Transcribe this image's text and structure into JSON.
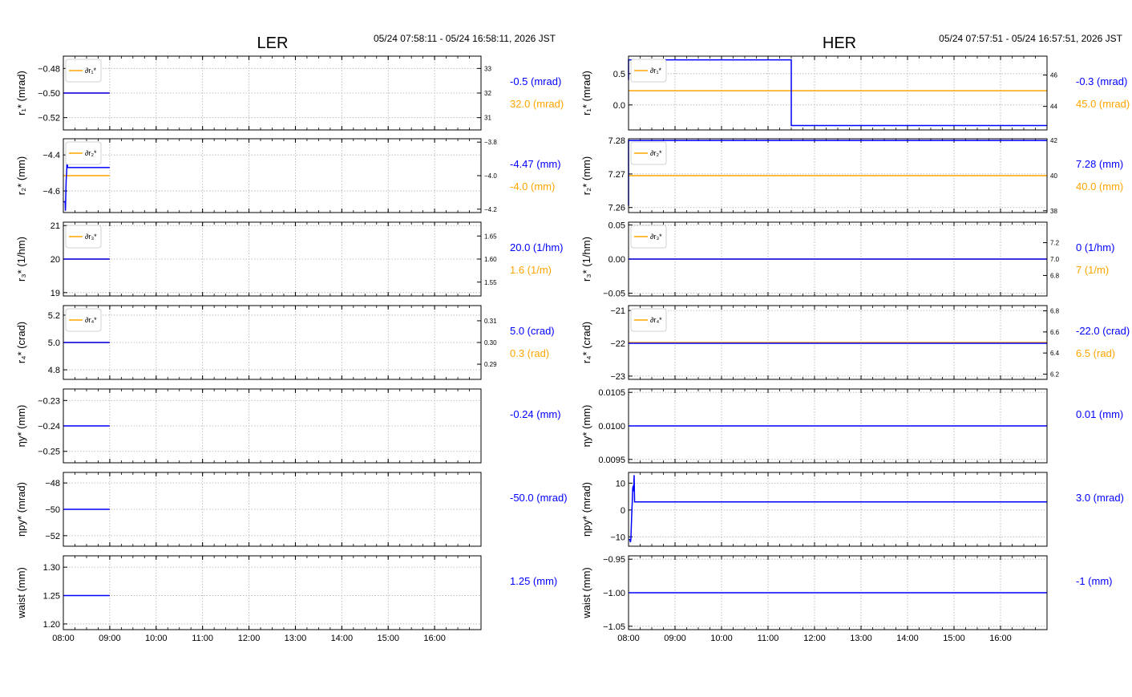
{
  "colors": {
    "blue": "#0000ff",
    "orange": "#ffa500",
    "grid": "#b0b0b0",
    "frame": "#000000"
  },
  "x_ticks": [
    "08:00",
    "09:00",
    "10:00",
    "11:00",
    "12:00",
    "13:00",
    "14:00",
    "15:00",
    "16:00"
  ],
  "panels": [
    {
      "id": "ler",
      "title": "LER",
      "time_range": "05/24 07:58:11 - 05/24 16:58:11, 2026 JST",
      "x_range": [
        8.0,
        9.0
      ],
      "rows": [
        {
          "ylabel": "r₁* (mrad)",
          "ylim": [
            -0.53,
            -0.47
          ],
          "yticks": [
            -0.48,
            -0.5,
            -0.52
          ],
          "ytick_labels": [
            "−0.48",
            "−0.50",
            "−0.52"
          ],
          "series": [
            {
              "t": [
                8.0,
                9.0
              ],
              "v": [
                -0.5,
                -0.5
              ]
            }
          ],
          "value": "-0.5 (mrad)",
          "legend": "∂r₁*",
          "right_ylim": [
            30.5,
            33.5
          ],
          "right_yticks": [
            31,
            32,
            33
          ],
          "right_ytick_labels": [
            "31",
            "32",
            "33"
          ],
          "right_series": [
            {
              "t": [
                8.0,
                9.0
              ],
              "v": [
                32.0,
                32.0
              ]
            }
          ],
          "right_value": "32.0 (mrad)"
        },
        {
          "ylabel": "r₂* (mm)",
          "ylim": [
            -4.72,
            -4.31
          ],
          "yticks": [
            -4.4,
            -4.6
          ],
          "ytick_labels": [
            "−4.4",
            "−4.6"
          ],
          "series": [
            {
              "t": [
                8.0,
                8.04,
                8.045,
                8.05,
                8.055,
                8.06,
                8.065,
                8.07,
                8.075,
                8.08,
                8.085,
                8.09,
                9.0
              ],
              "v": [
                -4.66,
                -4.66,
                -4.71,
                -4.66,
                -4.6,
                -4.55,
                -4.52,
                -4.5,
                -4.47,
                -4.42,
                -4.33,
                -4.47,
                -4.47
              ]
            }
          ],
          "value": "-4.47 (mm)",
          "legend": "∂r₂*",
          "right_ylim": [
            -4.22,
            -3.78
          ],
          "right_yticks": [
            -4.2,
            -4.0,
            -3.8
          ],
          "right_ytick_labels": [
            "−4.2",
            "−4.0",
            "−3.8"
          ],
          "right_series": [
            {
              "t": [
                8.0,
                9.0
              ],
              "v": [
                -4.0,
                -4.0
              ]
            }
          ],
          "right_value": "-4.0 (mm)"
        },
        {
          "ylabel": "r₃* (1/hm)",
          "ylim": [
            18.9,
            21.1
          ],
          "yticks": [
            19,
            20,
            21
          ],
          "ytick_labels": [
            "19",
            "20",
            "21"
          ],
          "series": [
            {
              "t": [
                8.0,
                9.0
              ],
              "v": [
                20.0,
                20.0
              ]
            }
          ],
          "value": "20.0 (1/hm)",
          "legend": "∂r₃*",
          "right_ylim": [
            1.52,
            1.68
          ],
          "right_yticks": [
            1.55,
            1.6,
            1.65
          ],
          "right_ytick_labels": [
            "1.55",
            "1.60",
            "1.65"
          ],
          "right_series": [
            {
              "t": [
                8.0,
                9.0
              ],
              "v": [
                1.6,
                1.6
              ]
            }
          ],
          "right_value": "1.6 (1/m)"
        },
        {
          "ylabel": "r₄* (crad)",
          "ylim": [
            4.73,
            5.27
          ],
          "yticks": [
            4.8,
            5.0,
            5.2
          ],
          "ytick_labels": [
            "4.8",
            "5.0",
            "5.2"
          ],
          "series": [
            {
              "t": [
                8.0,
                9.0
              ],
              "v": [
                5.0,
                5.0
              ]
            }
          ],
          "value": "5.0 (crad)",
          "legend": "∂r₄*",
          "right_ylim": [
            0.283,
            0.317
          ],
          "right_yticks": [
            0.29,
            0.3,
            0.31
          ],
          "right_ytick_labels": [
            "0.29",
            "0.30",
            "0.31"
          ],
          "right_series": [
            {
              "t": [
                8.0,
                9.0
              ],
              "v": [
                0.3,
                0.3
              ]
            }
          ],
          "right_value": "0.3 (rad)"
        },
        {
          "ylabel": "ηy* (mm)",
          "ylim": [
            -0.2545,
            -0.2255
          ],
          "yticks": [
            -0.23,
            -0.24,
            -0.25
          ],
          "ytick_labels": [
            "−0.23",
            "−0.24",
            "−0.25"
          ],
          "series": [
            {
              "t": [
                8.0,
                9.0
              ],
              "v": [
                -0.24,
                -0.24
              ]
            }
          ],
          "value": "-0.24 (mm)"
        },
        {
          "ylabel": "ηpy* (mrad)",
          "ylim": [
            -52.8,
            -47.2
          ],
          "yticks": [
            -48,
            -50,
            -52
          ],
          "ytick_labels": [
            "−48",
            "−50",
            "−52"
          ],
          "series": [
            {
              "t": [
                8.0,
                9.0
              ],
              "v": [
                -50.0,
                -50.0
              ]
            }
          ],
          "value": "-50.0 (mrad)"
        },
        {
          "ylabel": "waist (mm)",
          "ylim": [
            1.19,
            1.32
          ],
          "yticks": [
            1.2,
            1.25,
            1.3
          ],
          "ytick_labels": [
            "1.20",
            "1.25",
            "1.30"
          ],
          "series": [
            {
              "t": [
                8.0,
                9.0
              ],
              "v": [
                1.25,
                1.25
              ]
            }
          ],
          "value": "1.25 (mm)"
        }
      ]
    },
    {
      "id": "her",
      "title": "HER",
      "time_range": "05/24 07:57:51 - 05/24 16:57:51, 2026 JST",
      "x_range": [
        8.0,
        9.0
      ],
      "rows": [
        {
          "ylabel": "r₁* (mrad)",
          "ylim": [
            -0.4,
            0.78
          ],
          "yticks": [
            0.0,
            0.5
          ],
          "ytick_labels": [
            "0.0",
            "0.5"
          ],
          "series": [
            {
              "t": [
                8.0,
                8.0,
                11.5,
                11.5,
                17.0
              ],
              "v": [
                0.4,
                0.72,
                0.72,
                -0.33,
                -0.33
              ]
            }
          ],
          "value": "-0.3 (mrad)",
          "legend": "∂r₁*",
          "right_ylim": [
            42.5,
            47.2
          ],
          "right_yticks": [
            44,
            46
          ],
          "right_ytick_labels": [
            "44",
            "46"
          ],
          "right_series": [
            {
              "t": [
                8.0,
                17.0
              ],
              "v": [
                45.0,
                45.0
              ]
            }
          ],
          "right_value": "45.0 (mrad)"
        },
        {
          "ylabel": "r₂* (mm)",
          "ylim": [
            7.2585,
            7.2805
          ],
          "yticks": [
            7.26,
            7.27,
            7.28
          ],
          "ytick_labels": [
            "7.26",
            "7.27",
            "7.28"
          ],
          "series": [
            {
              "t": [
                8.0,
                8.0,
                17.0
              ],
              "v": [
                7.2605,
                7.28,
                7.28
              ]
            }
          ],
          "value": "7.28 (mm)",
          "legend": "∂r₂*",
          "right_ylim": [
            37.9,
            42.1
          ],
          "right_yticks": [
            38,
            40,
            42
          ],
          "right_ytick_labels": [
            "38",
            "40",
            "42"
          ],
          "right_series": [
            {
              "t": [
                8.0,
                17.0
              ],
              "v": [
                40.0,
                40.0
              ]
            }
          ],
          "right_value": "40.0 (mm)"
        },
        {
          "ylabel": "r₃* (1/hm)",
          "ylim": [
            -0.054,
            0.054
          ],
          "yticks": [
            -0.05,
            0.0,
            0.05
          ],
          "ytick_labels": [
            "−0.05",
            "0.00",
            "0.05"
          ],
          "series": [
            {
              "t": [
                8.0,
                17.0
              ],
              "v": [
                0.0,
                0.0
              ]
            }
          ],
          "value": "0 (1/hm)",
          "legend": "∂r₃*",
          "right_ylim": [
            6.55,
            7.45
          ],
          "right_yticks": [
            6.8,
            7.0,
            7.2
          ],
          "right_ytick_labels": [
            "6.8",
            "7.0",
            "7.2"
          ],
          "right_series": [
            {
              "t": [
                8.0,
                17.0
              ],
              "v": [
                7.0,
                7.0
              ]
            }
          ],
          "right_value": "7 (1/m)"
        },
        {
          "ylabel": "r₄* (crad)",
          "ylim": [
            -23.1,
            -20.85
          ],
          "yticks": [
            -21,
            -22,
            -23
          ],
          "ytick_labels": [
            "−21",
            "−22",
            "−23"
          ],
          "series": [
            {
              "t": [
                8.0,
                17.0
              ],
              "v": [
                -22.0,
                -22.0
              ]
            }
          ],
          "value": "-22.0 (crad)",
          "legend": "∂r₄*",
          "right_ylim": [
            6.15,
            6.85
          ],
          "right_yticks": [
            6.2,
            6.4,
            6.6,
            6.8
          ],
          "right_ytick_labels": [
            "6.2",
            "6.4",
            "6.6",
            "6.8"
          ],
          "right_series": [
            {
              "t": [
                8.0,
                17.0
              ],
              "v": [
                6.5,
                6.5
              ]
            }
          ],
          "right_value": "6.5 (rad)"
        },
        {
          "ylabel": "ηy* (mm)",
          "ylim": [
            0.00945,
            0.01055
          ],
          "yticks": [
            0.0095,
            0.01,
            0.0105
          ],
          "ytick_labels": [
            "0.0095",
            "0.0100",
            "0.0105"
          ],
          "series": [
            {
              "t": [
                8.0,
                17.0
              ],
              "v": [
                0.01,
                0.01
              ]
            }
          ],
          "value": "0.01 (mm)"
        },
        {
          "ylabel": "ηpy* (mrad)",
          "ylim": [
            -13.5,
            14.0
          ],
          "yticks": [
            -10,
            0,
            10
          ],
          "ytick_labels": [
            "−10",
            "0",
            "10"
          ],
          "series": [
            {
              "t": [
                8.0,
                8.03,
                8.04,
                8.05,
                8.06,
                8.07,
                8.08,
                8.09,
                8.1,
                8.11,
                8.12,
                8.13,
                8.14,
                17.0
              ],
              "v": [
                -11,
                -11,
                -12,
                -11,
                -6,
                -1,
                3,
                8,
                9,
                7,
                13,
                3,
                3,
                3
              ]
            }
          ],
          "value": "3.0 (mrad)"
        },
        {
          "ylabel": "waist (mm)",
          "ylim": [
            -1.055,
            -0.945
          ],
          "yticks": [
            -0.95,
            -1.0,
            -1.05
          ],
          "ytick_labels": [
            "−0.95",
            "−1.00",
            "−1.05"
          ],
          "series": [
            {
              "t": [
                8.0,
                17.0
              ],
              "v": [
                -1.0,
                -1.0
              ]
            }
          ],
          "value": "-1 (mm)"
        }
      ]
    }
  ],
  "chart_data": [
    {
      "type": "line",
      "title": "LER",
      "subtitle": "05/24 07:58:11 - 05/24 16:58:11, 2026 JST",
      "x_tick_labels": [
        "08:00",
        "09:00",
        "10:00",
        "11:00",
        "12:00",
        "13:00",
        "14:00",
        "15:00",
        "16:00"
      ],
      "series": [
        {
          "name": "r₁*",
          "values": [
            -0.5
          ],
          "unit": "mrad",
          "current": "-0.5 (mrad)"
        },
        {
          "name": "∂r₁*",
          "values": [
            32.0
          ],
          "unit": "mrad",
          "current": "32.0 (mrad)"
        },
        {
          "name": "r₂*",
          "values": [
            -4.66,
            -4.71,
            -4.33,
            -4.47
          ],
          "unit": "mm",
          "current": "-4.47 (mm)"
        },
        {
          "name": "∂r₂*",
          "values": [
            -4.0
          ],
          "unit": "mm",
          "current": "-4.0 (mm)"
        },
        {
          "name": "r₃*",
          "values": [
            20.0
          ],
          "unit": "1/hm",
          "current": "20.0 (1/hm)"
        },
        {
          "name": "∂r₃*",
          "values": [
            1.6
          ],
          "unit": "1/m",
          "current": "1.6 (1/m)"
        },
        {
          "name": "r₄*",
          "values": [
            5.0
          ],
          "unit": "crad",
          "current": "5.0 (crad)"
        },
        {
          "name": "∂r₄*",
          "values": [
            0.3
          ],
          "unit": "rad",
          "current": "0.3 (rad)"
        },
        {
          "name": "ηy*",
          "values": [
            -0.24
          ],
          "unit": "mm",
          "current": "-0.24 (mm)"
        },
        {
          "name": "ηpy*",
          "values": [
            -50.0
          ],
          "unit": "mrad",
          "current": "-50.0 (mrad)"
        },
        {
          "name": "waist",
          "values": [
            1.25
          ],
          "unit": "mm",
          "current": "1.25 (mm)"
        }
      ]
    },
    {
      "type": "line",
      "title": "HER",
      "subtitle": "05/24 07:57:51 - 05/24 16:57:51, 2026 JST",
      "x_tick_labels": [
        "08:00",
        "09:00",
        "10:00",
        "11:00",
        "12:00",
        "13:00",
        "14:00",
        "15:00",
        "16:00"
      ],
      "series": [
        {
          "name": "r₁*",
          "values": [
            0.72,
            -0.33
          ],
          "unit": "mrad",
          "current": "-0.3 (mrad)"
        },
        {
          "name": "∂r₁*",
          "values": [
            45.0
          ],
          "unit": "mrad",
          "current": "45.0 (mrad)"
        },
        {
          "name": "r₂*",
          "values": [
            7.28
          ],
          "unit": "mm",
          "current": "7.28 (mm)"
        },
        {
          "name": "∂r₂*",
          "values": [
            40.0
          ],
          "unit": "mm",
          "current": "40.0 (mm)"
        },
        {
          "name": "r₃*",
          "values": [
            0.0
          ],
          "unit": "1/hm",
          "current": "0 (1/hm)"
        },
        {
          "name": "∂r₃*",
          "values": [
            7.0
          ],
          "unit": "1/m",
          "current": "7 (1/m)"
        },
        {
          "name": "r₄*",
          "values": [
            -22.0
          ],
          "unit": "crad",
          "current": "-22.0 (crad)"
        },
        {
          "name": "∂r₄*",
          "values": [
            6.5
          ],
          "unit": "rad",
          "current": "6.5 (rad)"
        },
        {
          "name": "ηy*",
          "values": [
            0.01
          ],
          "unit": "mm",
          "current": "0.01 (mm)"
        },
        {
          "name": "ηpy*",
          "values": [
            -11,
            -12,
            13,
            3.0
          ],
          "unit": "mrad",
          "current": "3.0 (mrad)"
        },
        {
          "name": "waist",
          "values": [
            -1.0
          ],
          "unit": "mm",
          "current": "-1 (mm)"
        }
      ]
    }
  ]
}
